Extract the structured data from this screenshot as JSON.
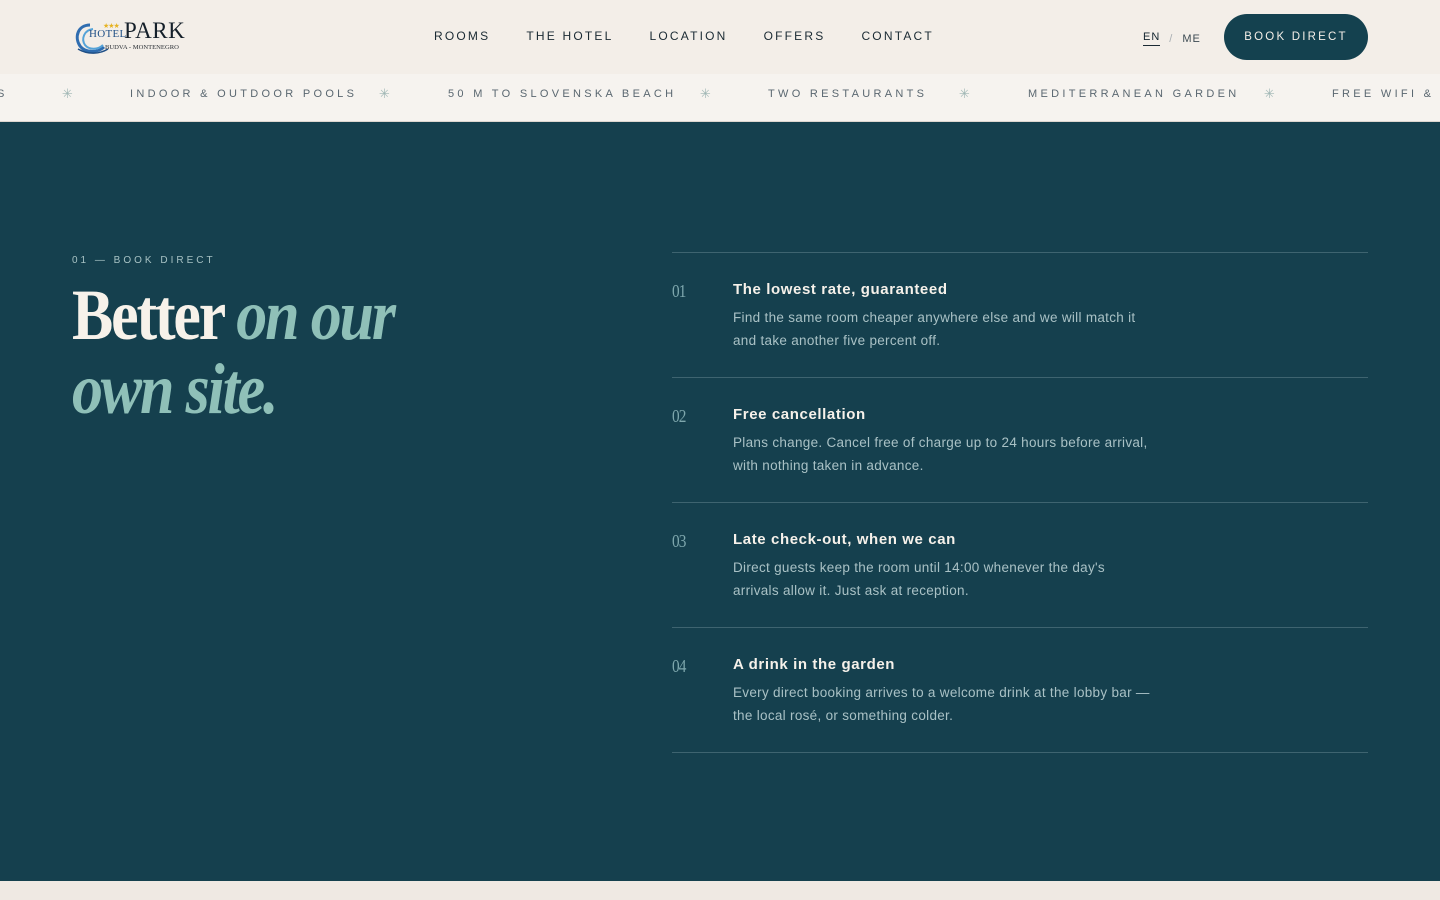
{
  "logo": {
    "hotel": "HOTEL",
    "park": "PARK",
    "stars": "★★★",
    "sub": "BUDVA - MONTENEGRO"
  },
  "nav": [
    "ROOMS",
    "THE HOTEL",
    "LOCATION",
    "OFFERS",
    "CONTACT"
  ],
  "lang": {
    "active": "EN",
    "separator": "/",
    "other": "ME"
  },
  "header_cta": "BOOK DIRECT",
  "marquee": {
    "items": [
      "S",
      "INDOOR & OUTDOOR POOLS",
      "50 M TO SLOVENSKA BEACH",
      "TWO RESTAURANTS",
      "MEDITERRANEAN GARDEN",
      "FREE WIFI & PA"
    ],
    "separator_icon": "asterisk-icon"
  },
  "section": {
    "eyebrow": "01 — BOOK DIRECT",
    "headline_plain": "Better",
    "headline_italic_1": "on our",
    "headline_italic_2": "own site."
  },
  "benefits": [
    {
      "num": "01",
      "title": "The lowest rate, guaranteed",
      "desc": "Find the same room cheaper anywhere else and we will match it and take another five percent off."
    },
    {
      "num": "02",
      "title": "Free cancellation",
      "desc": "Plans change. Cancel free of charge up to 24 hours before arrival, with nothing taken in advance."
    },
    {
      "num": "03",
      "title": "Late check-out, when we can",
      "desc": "Direct guests keep the room until 14:00 whenever the day's arrivals allow it. Just ask at reception."
    },
    {
      "num": "04",
      "title": "A drink in the garden",
      "desc": "Every direct booking arrives to a welcome drink at the lobby bar — the local rosé, or something colder."
    }
  ],
  "colors": {
    "primary": "#15404e",
    "accent": "#8fc0b8",
    "background": "#f1ece6",
    "logo_blue": "#1f4f86",
    "logo_star": "#e6b323"
  }
}
